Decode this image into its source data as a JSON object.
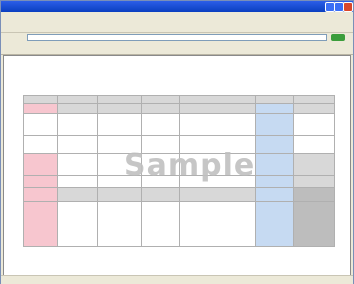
{
  "window": {
    "title": "",
    "minimize": "",
    "maximize": "",
    "close": ""
  },
  "menubar": {
    "items": [
      "",
      "",
      "",
      "",
      "",
      ""
    ]
  },
  "toolbar": {
    "items": [
      "",
      "",
      "",
      "",
      "",
      "",
      "",
      ""
    ]
  },
  "address": {
    "label": "",
    "value": "",
    "go": ""
  },
  "links": {
    "label": "",
    "items": [
      "",
      "",
      "",
      "",
      ""
    ]
  },
  "page": {
    "breadcrumb": "",
    "heading_line1": "",
    "heading_line2": "",
    "watermark": "Sample",
    "bottom_link": ""
  },
  "schedule": {
    "rows": [
      [
        "",
        "",
        "",
        "",
        "",
        "",
        ""
      ],
      [
        "",
        "",
        "",
        "",
        "",
        "",
        ""
      ],
      [
        "",
        "",
        "",
        "",
        "",
        "",
        ""
      ],
      [
        "",
        "",
        "",
        "",
        "",
        "",
        ""
      ],
      [
        "",
        "",
        "",
        "",
        "",
        "",
        ""
      ],
      [
        "",
        "",
        "",
        "",
        "",
        "",
        ""
      ],
      [
        "",
        "",
        "",
        "",
        "",
        "",
        ""
      ],
      [
        "",
        "",
        "",
        "",
        "",
        "",
        ""
      ]
    ]
  },
  "status": {
    "left": "",
    "right": ""
  },
  "colors": {
    "pink": "#f7c6cf",
    "blue": "#c6daf2",
    "gray": "#d8d8d8",
    "dark_gray": "#bdbdbd",
    "link": "#1f3c9e",
    "titlebar": "#0a3fc0"
  }
}
